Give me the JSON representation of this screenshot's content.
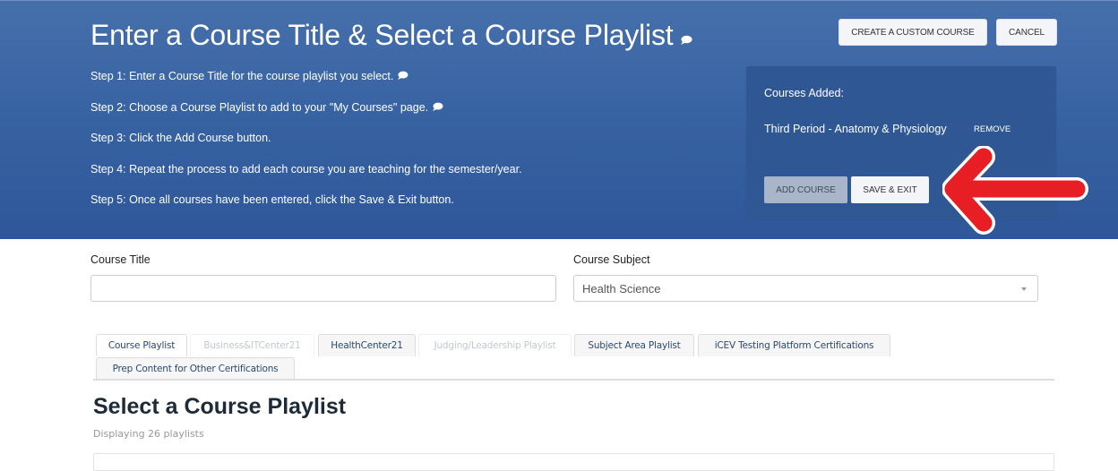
{
  "header": {
    "title": "Enter a Course Title & Select a Course Playlist",
    "title_icon": "speech-bubble-icon",
    "steps": [
      {
        "text": "Step 1: Enter a Course Title for the course playlist you select.",
        "icon": "speech-bubble-icon"
      },
      {
        "text": "Step 2: Choose a Course Playlist to add to your \"My Courses\" page.",
        "icon": "speech-bubble-icon"
      },
      {
        "text": "Step 3: Click the Add Course button."
      },
      {
        "text": "Step 4: Repeat the process to add each course you are teaching for the semester/year."
      },
      {
        "text": "Step 5: Once all courses have been entered, click the Save & Exit button."
      }
    ],
    "create_custom_course_label": "CREATE A CUSTOM COURSE",
    "cancel_label": "CANCEL"
  },
  "courses_panel": {
    "heading": "Courses Added:",
    "courses": [
      {
        "name": "Third Period - Anatomy & Physiology",
        "remove_label": "REMOVE"
      }
    ],
    "add_course_label": "ADD COURSE",
    "save_exit_label": "SAVE & EXIT",
    "annotation": {
      "type": "arrow",
      "direction": "left",
      "color": "#e81e25",
      "points_to": "SAVE & EXIT"
    }
  },
  "form": {
    "course_title_label": "Course Title",
    "course_title_value": "",
    "course_subject_label": "Course Subject",
    "course_subject_value": "Health Science"
  },
  "tabs": [
    {
      "label": "Course Playlist",
      "state": "active"
    },
    {
      "label": "Business&ITCenter21",
      "state": "disabled"
    },
    {
      "label": "HealthCenter21",
      "state": "normal"
    },
    {
      "label": "Judging/Leadership Playlist",
      "state": "disabled"
    },
    {
      "label": "Subject Area Playlist",
      "state": "normal"
    },
    {
      "label": "iCEV Testing Platform Certifications",
      "state": "normal"
    },
    {
      "label": "Prep Content for Other Certifications",
      "state": "normal"
    }
  ],
  "playlist_section": {
    "title": "Select a Course Playlist",
    "subtitle": "Displaying 26 playlists"
  },
  "colors": {
    "header_blue": "#3762a2",
    "panel_blue": "#2f5793",
    "annotation_red": "#e81e25",
    "tab_text": "#2b4a6f"
  }
}
